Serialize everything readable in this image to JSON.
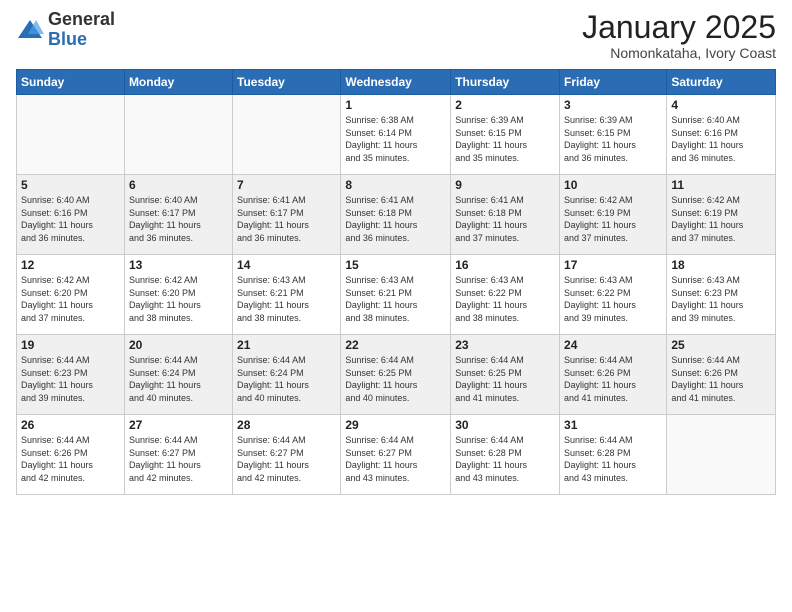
{
  "logo": {
    "general": "General",
    "blue": "Blue"
  },
  "title": "January 2025",
  "location": "Nomonkataha, Ivory Coast",
  "days_header": [
    "Sunday",
    "Monday",
    "Tuesday",
    "Wednesday",
    "Thursday",
    "Friday",
    "Saturday"
  ],
  "weeks": [
    {
      "shaded": false,
      "days": [
        {
          "num": "",
          "info": ""
        },
        {
          "num": "",
          "info": ""
        },
        {
          "num": "",
          "info": ""
        },
        {
          "num": "1",
          "info": "Sunrise: 6:38 AM\nSunset: 6:14 PM\nDaylight: 11 hours\nand 35 minutes."
        },
        {
          "num": "2",
          "info": "Sunrise: 6:39 AM\nSunset: 6:15 PM\nDaylight: 11 hours\nand 35 minutes."
        },
        {
          "num": "3",
          "info": "Sunrise: 6:39 AM\nSunset: 6:15 PM\nDaylight: 11 hours\nand 36 minutes."
        },
        {
          "num": "4",
          "info": "Sunrise: 6:40 AM\nSunset: 6:16 PM\nDaylight: 11 hours\nand 36 minutes."
        }
      ]
    },
    {
      "shaded": true,
      "days": [
        {
          "num": "5",
          "info": "Sunrise: 6:40 AM\nSunset: 6:16 PM\nDaylight: 11 hours\nand 36 minutes."
        },
        {
          "num": "6",
          "info": "Sunrise: 6:40 AM\nSunset: 6:17 PM\nDaylight: 11 hours\nand 36 minutes."
        },
        {
          "num": "7",
          "info": "Sunrise: 6:41 AM\nSunset: 6:17 PM\nDaylight: 11 hours\nand 36 minutes."
        },
        {
          "num": "8",
          "info": "Sunrise: 6:41 AM\nSunset: 6:18 PM\nDaylight: 11 hours\nand 36 minutes."
        },
        {
          "num": "9",
          "info": "Sunrise: 6:41 AM\nSunset: 6:18 PM\nDaylight: 11 hours\nand 37 minutes."
        },
        {
          "num": "10",
          "info": "Sunrise: 6:42 AM\nSunset: 6:19 PM\nDaylight: 11 hours\nand 37 minutes."
        },
        {
          "num": "11",
          "info": "Sunrise: 6:42 AM\nSunset: 6:19 PM\nDaylight: 11 hours\nand 37 minutes."
        }
      ]
    },
    {
      "shaded": false,
      "days": [
        {
          "num": "12",
          "info": "Sunrise: 6:42 AM\nSunset: 6:20 PM\nDaylight: 11 hours\nand 37 minutes."
        },
        {
          "num": "13",
          "info": "Sunrise: 6:42 AM\nSunset: 6:20 PM\nDaylight: 11 hours\nand 38 minutes."
        },
        {
          "num": "14",
          "info": "Sunrise: 6:43 AM\nSunset: 6:21 PM\nDaylight: 11 hours\nand 38 minutes."
        },
        {
          "num": "15",
          "info": "Sunrise: 6:43 AM\nSunset: 6:21 PM\nDaylight: 11 hours\nand 38 minutes."
        },
        {
          "num": "16",
          "info": "Sunrise: 6:43 AM\nSunset: 6:22 PM\nDaylight: 11 hours\nand 38 minutes."
        },
        {
          "num": "17",
          "info": "Sunrise: 6:43 AM\nSunset: 6:22 PM\nDaylight: 11 hours\nand 39 minutes."
        },
        {
          "num": "18",
          "info": "Sunrise: 6:43 AM\nSunset: 6:23 PM\nDaylight: 11 hours\nand 39 minutes."
        }
      ]
    },
    {
      "shaded": true,
      "days": [
        {
          "num": "19",
          "info": "Sunrise: 6:44 AM\nSunset: 6:23 PM\nDaylight: 11 hours\nand 39 minutes."
        },
        {
          "num": "20",
          "info": "Sunrise: 6:44 AM\nSunset: 6:24 PM\nDaylight: 11 hours\nand 40 minutes."
        },
        {
          "num": "21",
          "info": "Sunrise: 6:44 AM\nSunset: 6:24 PM\nDaylight: 11 hours\nand 40 minutes."
        },
        {
          "num": "22",
          "info": "Sunrise: 6:44 AM\nSunset: 6:25 PM\nDaylight: 11 hours\nand 40 minutes."
        },
        {
          "num": "23",
          "info": "Sunrise: 6:44 AM\nSunset: 6:25 PM\nDaylight: 11 hours\nand 41 minutes."
        },
        {
          "num": "24",
          "info": "Sunrise: 6:44 AM\nSunset: 6:26 PM\nDaylight: 11 hours\nand 41 minutes."
        },
        {
          "num": "25",
          "info": "Sunrise: 6:44 AM\nSunset: 6:26 PM\nDaylight: 11 hours\nand 41 minutes."
        }
      ]
    },
    {
      "shaded": false,
      "days": [
        {
          "num": "26",
          "info": "Sunrise: 6:44 AM\nSunset: 6:26 PM\nDaylight: 11 hours\nand 42 minutes."
        },
        {
          "num": "27",
          "info": "Sunrise: 6:44 AM\nSunset: 6:27 PM\nDaylight: 11 hours\nand 42 minutes."
        },
        {
          "num": "28",
          "info": "Sunrise: 6:44 AM\nSunset: 6:27 PM\nDaylight: 11 hours\nand 42 minutes."
        },
        {
          "num": "29",
          "info": "Sunrise: 6:44 AM\nSunset: 6:27 PM\nDaylight: 11 hours\nand 43 minutes."
        },
        {
          "num": "30",
          "info": "Sunrise: 6:44 AM\nSunset: 6:28 PM\nDaylight: 11 hours\nand 43 minutes."
        },
        {
          "num": "31",
          "info": "Sunrise: 6:44 AM\nSunset: 6:28 PM\nDaylight: 11 hours\nand 43 minutes."
        },
        {
          "num": "",
          "info": ""
        }
      ]
    }
  ]
}
